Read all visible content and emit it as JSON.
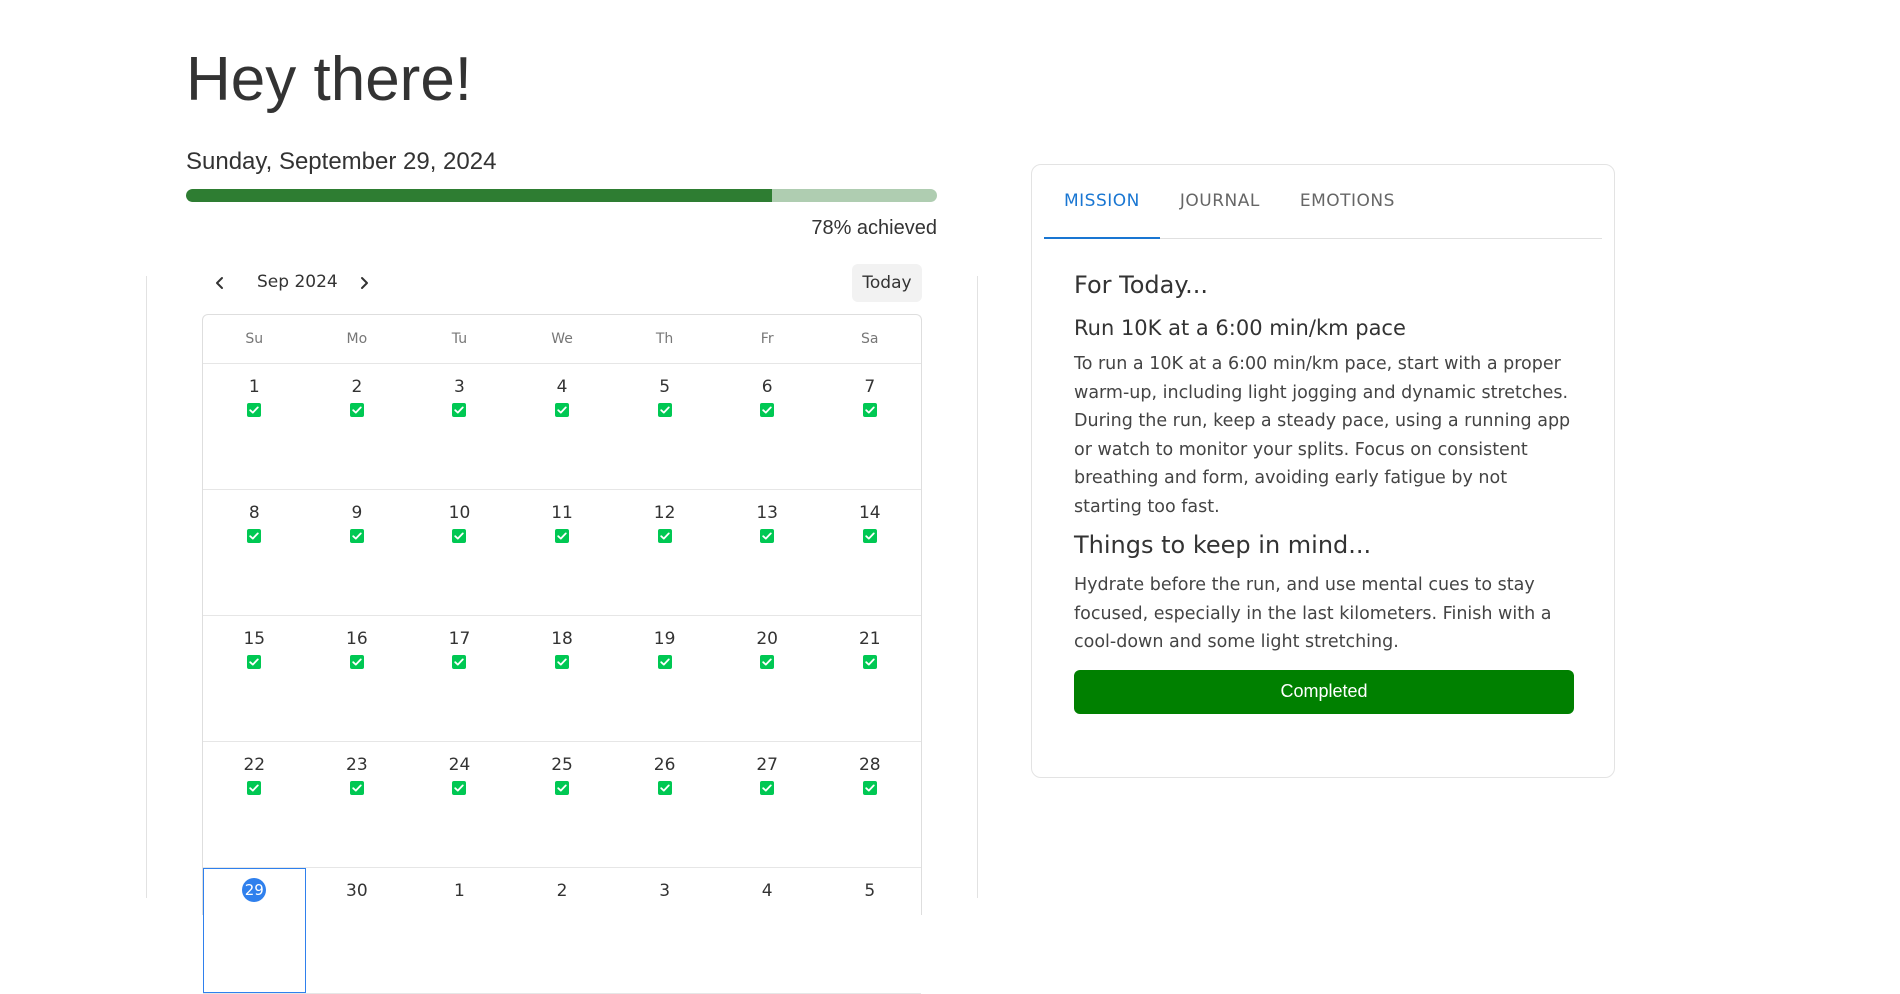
{
  "header": {
    "greeting": "Hey there!",
    "date": "Sunday, September 29, 2024",
    "progress_percent": 78,
    "progress_label": "78% achieved",
    "progress_color": "#2e7d32",
    "progress_track_color": "#afcdb1"
  },
  "calendar": {
    "month_label": "Sep 2024",
    "today_label": "Today",
    "weekdays": [
      "Su",
      "Mo",
      "Tu",
      "We",
      "Th",
      "Fr",
      "Sa"
    ],
    "selected_day": 29,
    "check_color": "#00c853",
    "weeks": [
      [
        {
          "day": "1",
          "done": true
        },
        {
          "day": "2",
          "done": true
        },
        {
          "day": "3",
          "done": true
        },
        {
          "day": "4",
          "done": true
        },
        {
          "day": "5",
          "done": true
        },
        {
          "day": "6",
          "done": true
        },
        {
          "day": "7",
          "done": true
        }
      ],
      [
        {
          "day": "8",
          "done": true
        },
        {
          "day": "9",
          "done": true
        },
        {
          "day": "10",
          "done": true
        },
        {
          "day": "11",
          "done": true
        },
        {
          "day": "12",
          "done": true
        },
        {
          "day": "13",
          "done": true
        },
        {
          "day": "14",
          "done": true
        }
      ],
      [
        {
          "day": "15",
          "done": true
        },
        {
          "day": "16",
          "done": true
        },
        {
          "day": "17",
          "done": true
        },
        {
          "day": "18",
          "done": true
        },
        {
          "day": "19",
          "done": true
        },
        {
          "day": "20",
          "done": true
        },
        {
          "day": "21",
          "done": true
        }
      ],
      [
        {
          "day": "22",
          "done": true
        },
        {
          "day": "23",
          "done": true
        },
        {
          "day": "24",
          "done": true
        },
        {
          "day": "25",
          "done": true
        },
        {
          "day": "26",
          "done": true
        },
        {
          "day": "27",
          "done": true
        },
        {
          "day": "28",
          "done": true
        }
      ],
      [
        {
          "day": "29",
          "done": false,
          "selected": true
        },
        {
          "day": "30",
          "done": false
        },
        {
          "day": "1",
          "done": false
        },
        {
          "day": "2",
          "done": false
        },
        {
          "day": "3",
          "done": false
        },
        {
          "day": "4",
          "done": false
        },
        {
          "day": "5",
          "done": false
        }
      ]
    ]
  },
  "mission_card": {
    "tabs": [
      {
        "label": "MISSION",
        "active": true
      },
      {
        "label": "JOURNAL",
        "active": false
      },
      {
        "label": "EMOTIONS",
        "active": false
      }
    ],
    "for_today_heading": "For Today...",
    "goal": "Run 10K at a 6:00 min/km pace",
    "description": "To run a 10K at a 6:00 min/km pace, start with a proper warm-up, including light jogging and dynamic stretches. During the run, keep a steady pace, using a running app or watch to monitor your splits. Focus on consistent breathing and form, avoiding early fatigue by not starting too fast.",
    "keep_in_mind_heading": "Things to keep in mind...",
    "keep_in_mind": "Hydrate before the run, and use mental cues to stay focused, especially in the last kilometers. Finish with a cool-down and some light stretching.",
    "completed_label": "Completed",
    "accent_color": "#1976d2",
    "completed_color": "#008000"
  },
  "icons": {
    "prev": "chevron-left-icon",
    "next": "chevron-right-icon",
    "check": "checkbox-checked-icon"
  }
}
